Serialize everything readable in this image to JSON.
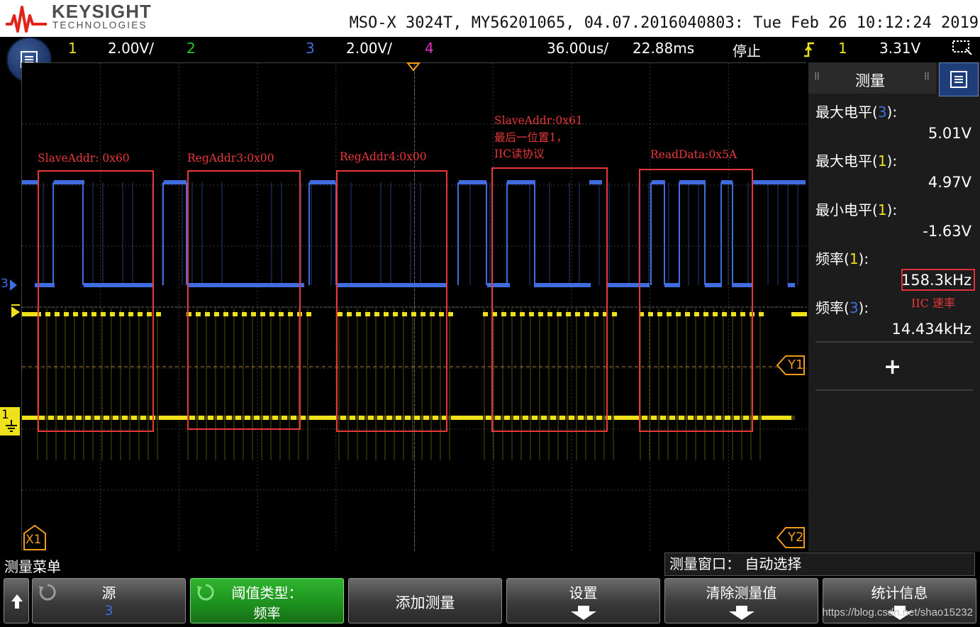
{
  "header": {
    "brand": "KEYSIGHT",
    "brand_sub": "TECHNOLOGIES",
    "instrument_info": "MSO-X 3024T, MY56201065, 04.07.2016040803: Tue Feb 26 10:12:24 2019"
  },
  "status": {
    "ch1_num": "1",
    "ch1_scale": "2.00V/",
    "ch2_num": "2",
    "ch3_num": "3",
    "ch3_scale": "2.00V/",
    "ch4_num": "4",
    "timebase": "36.00us/",
    "delay": "22.88ms",
    "run_state": "停止",
    "trigger_source": "1",
    "trigger_level": "3.31V"
  },
  "colors": {
    "ch1": "#f0e21a",
    "ch2": "#29c629",
    "ch3": "#3f6de0",
    "ch4": "#e030c0",
    "annotation": "#e8383a",
    "accent_green": "#1d8f1d"
  },
  "markers": {
    "ch3_marker": "3",
    "ch1_marker": "1",
    "y1": "Y1",
    "y2": "Y2",
    "x1": "X1"
  },
  "annotations": [
    {
      "lines": [
        "SlaveAddr: 0x60"
      ]
    },
    {
      "lines": [
        "RegAddr3:0x00"
      ]
    },
    {
      "lines": [
        "RegAddr4:0x00"
      ]
    },
    {
      "lines": [
        "SlaveAddr:0x61",
        "最后一位置1，",
        "IIC读协议"
      ]
    },
    {
      "lines": [
        "ReadData:0x5A"
      ]
    }
  ],
  "measurements": {
    "title": "测量",
    "items": [
      {
        "label": "最大电平",
        "source": "3",
        "value": "5.01V"
      },
      {
        "label": "最大电平",
        "source": "1",
        "value": "4.97V"
      },
      {
        "label": "最小电平",
        "source": "1",
        "value": "-1.63V"
      },
      {
        "label": "频率",
        "source": "1",
        "value": "158.3kHz"
      },
      {
        "label": "频率",
        "source": "3",
        "value": "14.434kHz"
      }
    ],
    "note": "IIC 速率",
    "add_icon": "plus-icon"
  },
  "bottom": {
    "menu_title": "测量菜单",
    "window_label": "测量窗口：",
    "window_value": "自动选择",
    "softkeys": {
      "source_label": "源",
      "source_value": "3",
      "threshold_label": "阈值类型：",
      "threshold_value": "频率",
      "add_measurement": "添加测量",
      "settings": "设置",
      "clear": "清除测量值",
      "stats": "统计信息"
    },
    "watermark": "https://blog.csdn.net/shao15232"
  }
}
